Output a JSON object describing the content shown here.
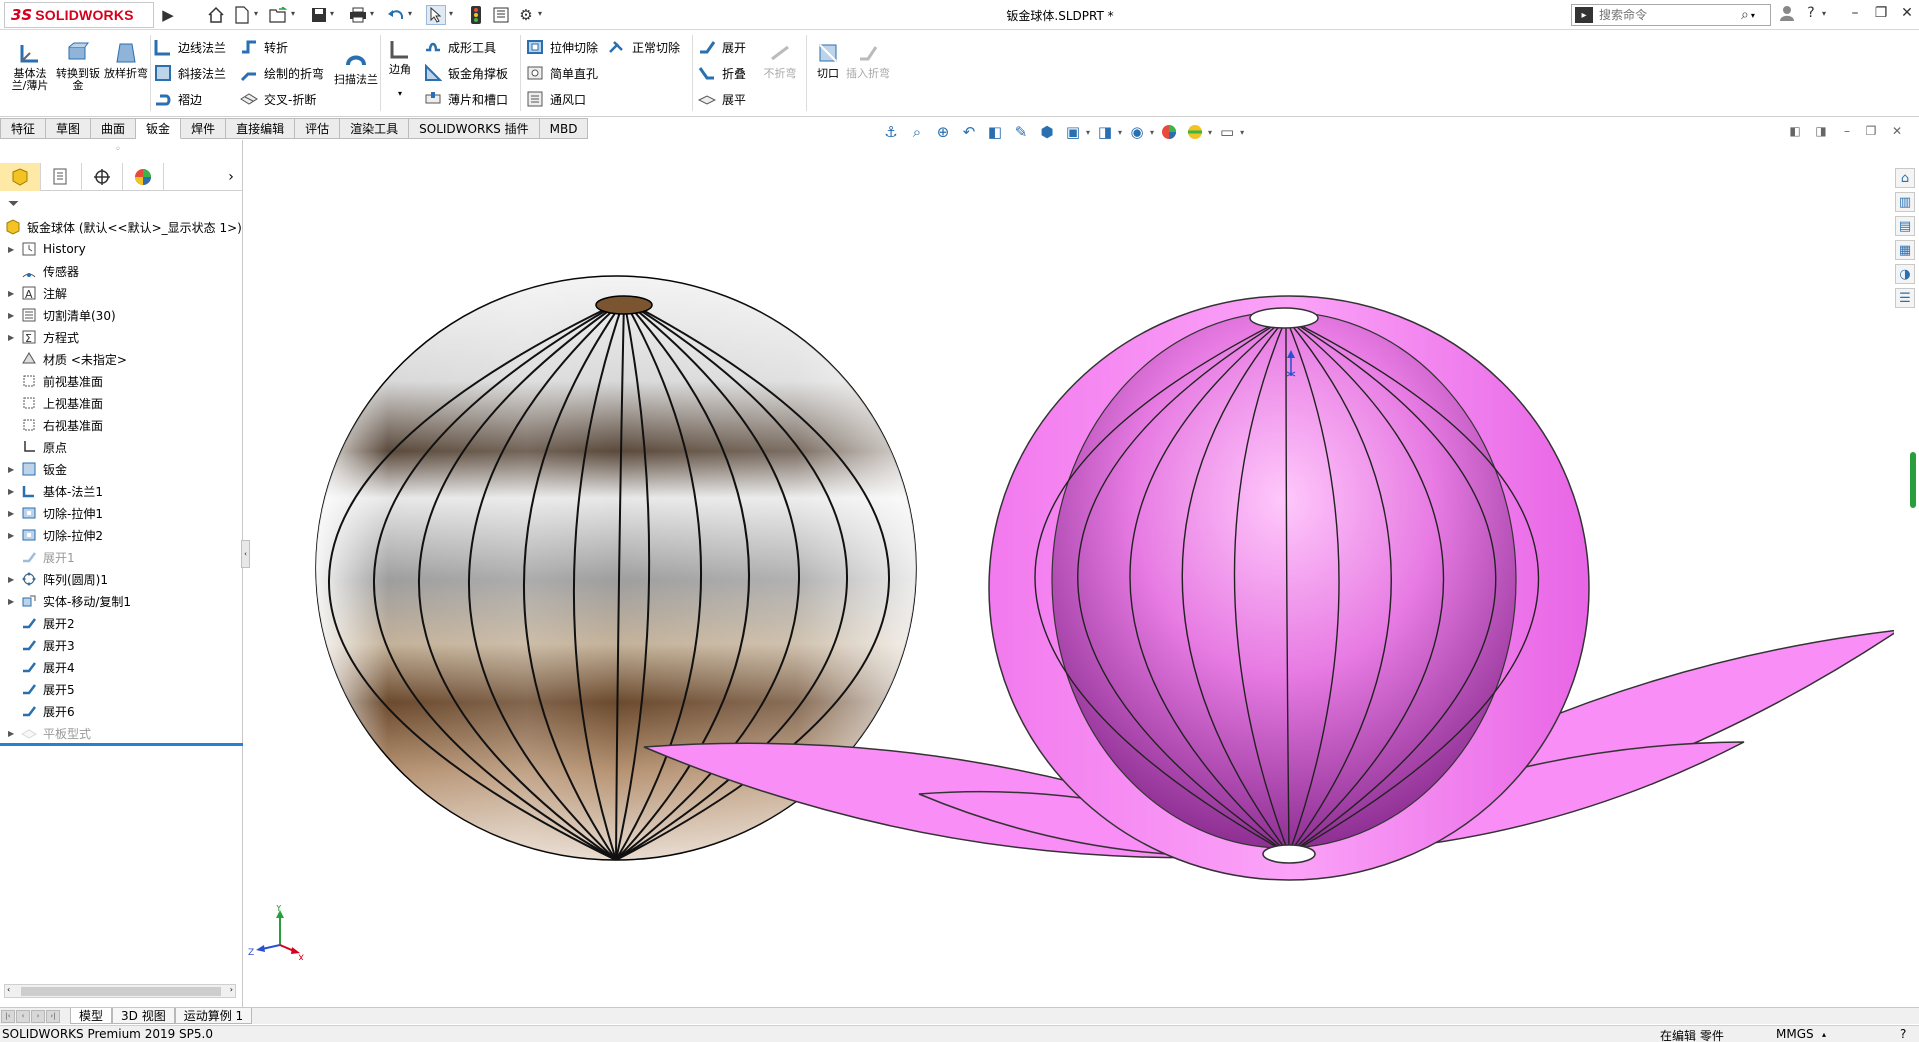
{
  "app": {
    "brand_ds": "3S",
    "brand_name": "SOLIDWORKS",
    "document_title": "钣金球体.SLDPRT *"
  },
  "search": {
    "placeholder": "搜索命令"
  },
  "ribbon": {
    "big_buttons": [
      {
        "id": "base-flange",
        "label": "基体法兰/薄片"
      },
      {
        "id": "convert",
        "label": "转换到钣金"
      },
      {
        "id": "lofted-bend",
        "label": "放样折弯"
      }
    ],
    "group1": [
      "边线法兰",
      "斜接法兰",
      "褶边"
    ],
    "group2": [
      "转折",
      "绘制的折弯",
      "交叉-折断"
    ],
    "sweep_flange": "扫描法兰",
    "corners": "边角",
    "group3": [
      "成形工具",
      "钣金角撑板",
      "薄片和槽口"
    ],
    "group4": [
      "拉伸切除",
      "简单直孔",
      "通风口"
    ],
    "normal_cut": "正常切除",
    "group5": [
      "展开",
      "折叠",
      "展平"
    ],
    "no_bends": "不折弯",
    "rip": "切口",
    "insert_bends": "插入折弯"
  },
  "command_tabs": [
    "特征",
    "草图",
    "曲面",
    "钣金",
    "焊件",
    "直接编辑",
    "评估",
    "渲染工具",
    "SOLIDWORKS 插件",
    "MBD"
  ],
  "active_command_tab": "钣金",
  "feature_tree": {
    "root": "钣金球体  (默认<<默认>_显示状态 1>)",
    "items": [
      {
        "label": "History",
        "icon": "history-icon",
        "expand": true,
        "grey": false
      },
      {
        "label": "传感器",
        "icon": "sensor-icon",
        "expand": false,
        "grey": false
      },
      {
        "label": "注解",
        "icon": "annotation-icon",
        "expand": true,
        "grey": false
      },
      {
        "label": "切割清单(30)",
        "icon": "cutlist-icon",
        "expand": true,
        "grey": false
      },
      {
        "label": "方程式",
        "icon": "equation-icon",
        "expand": true,
        "grey": false
      },
      {
        "label": "材质 <未指定>",
        "icon": "material-icon",
        "expand": false,
        "grey": false
      },
      {
        "label": "前视基准面",
        "icon": "plane-icon",
        "expand": false,
        "grey": false
      },
      {
        "label": "上视基准面",
        "icon": "plane-icon",
        "expand": false,
        "grey": false
      },
      {
        "label": "右视基准面",
        "icon": "plane-icon",
        "expand": false,
        "grey": false
      },
      {
        "label": "原点",
        "icon": "origin-icon",
        "expand": false,
        "grey": false
      },
      {
        "label": "钣金",
        "icon": "sheetmetal-icon",
        "expand": true,
        "grey": false
      },
      {
        "label": "基体-法兰1",
        "icon": "base-flange-icon",
        "expand": true,
        "grey": false
      },
      {
        "label": "切除-拉伸1",
        "icon": "cut-extrude-icon",
        "expand": true,
        "grey": false
      },
      {
        "label": "切除-拉伸2",
        "icon": "cut-extrude-icon",
        "expand": true,
        "grey": false
      },
      {
        "label": "展开1",
        "icon": "unfold-icon",
        "expand": false,
        "grey": true
      },
      {
        "label": "阵列(圆周)1",
        "icon": "circular-pattern-icon",
        "expand": true,
        "grey": false
      },
      {
        "label": "实体-移动/复制1",
        "icon": "move-copy-icon",
        "expand": true,
        "grey": false
      },
      {
        "label": "展开2",
        "icon": "unfold-icon",
        "expand": false,
        "grey": false
      },
      {
        "label": "展开3",
        "icon": "unfold-icon",
        "expand": false,
        "grey": false
      },
      {
        "label": "展开4",
        "icon": "unfold-icon",
        "expand": false,
        "grey": false
      },
      {
        "label": "展开5",
        "icon": "unfold-icon",
        "expand": false,
        "grey": false
      },
      {
        "label": "展开6",
        "icon": "unfold-icon",
        "expand": false,
        "grey": false
      },
      {
        "label": "平板型式",
        "icon": "flat-pattern-icon",
        "expand": true,
        "grey": true
      }
    ]
  },
  "bottom_tabs": [
    "模型",
    "3D 视图",
    "运动算例 1"
  ],
  "active_bottom_tab": "模型",
  "status": {
    "version": "SOLIDWORKS Premium 2019 SP5.0",
    "mode": "在编辑 零件",
    "units": "MMGS"
  },
  "triad": {
    "x": "X",
    "y": "Y",
    "z": "Z"
  },
  "colors": {
    "petal": "#f98ef6",
    "petal_dark": "#9c3aa0",
    "accent_blue": "#2c7fd0",
    "brand_red": "#d6001c"
  }
}
